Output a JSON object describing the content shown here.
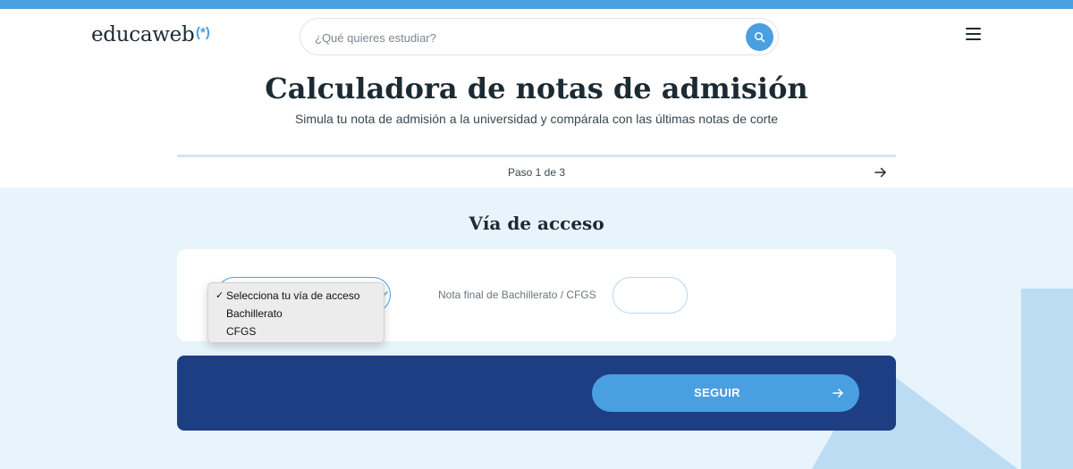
{
  "header": {
    "logo_text": "educaweb",
    "logo_mark": "(*)",
    "search": {
      "placeholder": "¿Qué quieres estudiar?",
      "value": ""
    },
    "icons": {
      "search": "search-icon",
      "menu": "hamburger-menu-icon"
    }
  },
  "main": {
    "title": "Calculadora de notas de admisión",
    "subtitle": "Simula tu nota de admisión a la universidad y compárala con las últimas notas de corte",
    "step": {
      "text": "Paso 1 de 3",
      "icon": "arrow-right-icon"
    }
  },
  "form": {
    "section_title": "Vía de acceso",
    "access_select": {
      "selected": "Selecciona tu vía de acceso",
      "options": [
        "Selecciona tu vía de acceso",
        "Bachillerato",
        "CFGS"
      ]
    },
    "grade_label": "Nota final de Bachillerato / CFGS",
    "grade_value": ""
  },
  "cta": {
    "label": "SEGUIR",
    "icon": "arrow-right-icon"
  },
  "colors": {
    "accent": "#4a9fe0",
    "dark_panel": "#1e3e84",
    "light_band": "#e8f4fb",
    "text": "#1c2b33"
  }
}
